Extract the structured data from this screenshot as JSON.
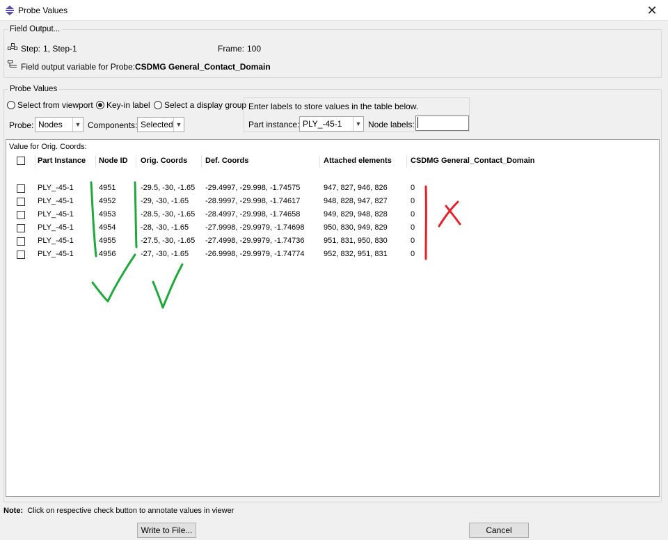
{
  "window": {
    "title": "Probe Values",
    "close_glyph": "✕"
  },
  "field_output": {
    "legend": "Field Output...",
    "step_label": "Step:",
    "step_value": "1, Step-1",
    "frame_label": "Frame:",
    "frame_value": "100",
    "variable_label": "Field output variable for Probe:",
    "variable_value": "CSDMG General_Contact_Domain"
  },
  "probe_values": {
    "legend": "Probe Values",
    "radio_viewport": "Select from viewport",
    "radio_keyin": "Key-in label",
    "radio_display_group": "Select a display group",
    "selected_radio": "Key-in label",
    "probe_label": "Probe:",
    "probe_value": "Nodes",
    "components_label": "Components:",
    "components_value": "Selected",
    "keyin_hint": "Enter labels to store values in the table below.",
    "part_instance_label": "Part instance:",
    "part_instance_value": "PLY_-45-1",
    "node_labels_label": "Node labels:",
    "node_labels_value": ""
  },
  "table": {
    "caption": "Value for Orig. Coords:",
    "columns": [
      "Part Instance",
      "Node ID",
      "Orig. Coords",
      "Def. Coords",
      "Attached elements",
      "CSDMG General_Contact_Domain"
    ],
    "rows": [
      [
        "PLY_-45-1",
        "4951",
        "-29.5, -30, -1.65",
        "-29.4997, -29.998, -1.74575",
        "947, 827, 946, 826",
        "0"
      ],
      [
        "PLY_-45-1",
        "4952",
        "-29, -30, -1.65",
        "-28.9997, -29.998, -1.74617",
        "948, 828, 947, 827",
        "0"
      ],
      [
        "PLY_-45-1",
        "4953",
        "-28.5, -30, -1.65",
        "-28.4997, -29.998, -1.74658",
        "949, 829, 948, 828",
        "0"
      ],
      [
        "PLY_-45-1",
        "4954",
        "-28, -30, -1.65",
        "-27.9998, -29.9979, -1.74698",
        "950, 830, 949, 829",
        "0"
      ],
      [
        "PLY_-45-1",
        "4955",
        "-27.5, -30, -1.65",
        "-27.4998, -29.9979, -1.74736",
        "951, 831, 950, 830",
        "0"
      ],
      [
        "PLY_-45-1",
        "4956",
        "-27, -30, -1.65",
        "-26.9998, -29.9979, -1.74774",
        "952, 832, 951, 831",
        "0"
      ]
    ]
  },
  "footer": {
    "note_label": "Note:",
    "note_text": "Click on respective check button to annotate values in viewer",
    "write_button": "Write to File...",
    "cancel_button": "Cancel"
  },
  "colors": {
    "annotation_green": "#1fa83a",
    "annotation_red": "#e8202a",
    "dialog_bg": "#f0f0f0"
  }
}
